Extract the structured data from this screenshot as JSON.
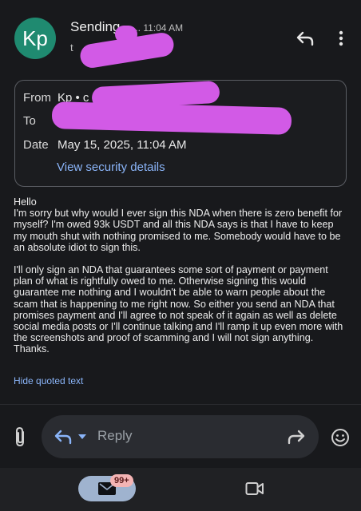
{
  "header": {
    "avatar_initials": "Kp",
    "sender_name": "Sending",
    "time": "... 11:04 AM",
    "to_short": "t"
  },
  "details": {
    "from_label": "From",
    "from_value": "Kp • c",
    "to_label": "To",
    "date_label": "Date",
    "date_value": "May 15, 2025, 11:04 AM",
    "security_link": "View security details"
  },
  "email": {
    "paragraphs": [
      "Hello",
      "I'm sorry but why would I ever sign this NDA when there is zero benefit for myself? I'm owed 93k USDT and all this NDA says is that I have to keep my mouth shut with nothing promised to me. Somebody would have to be an absolute idiot to sign this.",
      "I'll only sign an NDA that guarantees some sort of payment or payment plan of what is rightfully owed to me. Otherwise signing this would guarantee me nothing and I wouldn't be able to warn people about the scam that is happening to me right now. So either you send an NDA that promises payment and I'll agree to not speak of it again as well as delete social media posts or I'll continue talking and I'll ramp it up even more with the screenshots and proof of scamming and I will not sign anything.",
      "Thanks."
    ],
    "hide_quoted": "Hide quoted text"
  },
  "compose": {
    "reply_placeholder": "Reply"
  },
  "bottom_nav": {
    "mail_badge": "99+"
  },
  "colors": {
    "background": "#18191c",
    "accent_link": "#8ab4f8",
    "avatar": "#1f8a70",
    "redaction": "#d25ae6"
  }
}
